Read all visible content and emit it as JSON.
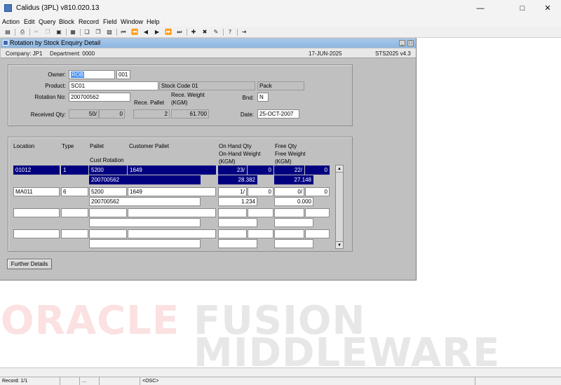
{
  "window": {
    "title": "Calidus (3PL) v810.020.13"
  },
  "menu": [
    "Action",
    "Edit",
    "Query",
    "Block",
    "Record",
    "Field",
    "Window",
    "Help"
  ],
  "form": {
    "title": "Rotation by Stock Enquiry Detail",
    "company": "Company:  JP1",
    "department": "Department:  0000",
    "date": "17-JUN-2025",
    "version_code": "STS2025  v4.3"
  },
  "header": {
    "owner_label": "Owner:",
    "owner": "ROB",
    "owner_code": "001",
    "product_label": "Product:",
    "product": "SC01",
    "product_desc": "Stock Code 01",
    "pack": "Pack",
    "rotation_label": "Rotation No:",
    "rotation_no": "200700562",
    "rece_weight_label_1": "Rece. Weight",
    "rece_weight_label_2": "(KGM)",
    "rece_pallet_label": "Rece. Pallet",
    "bnd_label": "Bnd:",
    "bnd": "N",
    "received_qty_label": "Received Qty:",
    "received_qty_1": "50/",
    "received_qty_2": "0",
    "rece_pallet": "2",
    "rece_weight": "61.700",
    "date_label": "Date:",
    "date": "25-OCT-2007"
  },
  "grid": {
    "headers": {
      "location": "Location",
      "type": "Type",
      "pallet": "Pallet",
      "customer_pallet": "Customer Pallet",
      "on_hand_1": "On Hand Qty",
      "on_hand_2": "On-Hand Weight",
      "on_hand_3": "(KGM)",
      "free_1": "Free Qty",
      "free_2": "Free Weight",
      "free_3": "(KGM)",
      "cust_rotation": "Cust Rotation"
    },
    "rows": [
      {
        "location": "01012",
        "type": "1",
        "pallet": "5200",
        "customer_pallet": "1649",
        "on_hand_qty": "23/",
        "on_hand_qty2": "0",
        "free_qty": "22/",
        "free_qty2": "0",
        "cust_rotation": "200700562",
        "on_hand_weight": "28.382",
        "free_weight": "27.148"
      },
      {
        "location": "MA011",
        "type": "6",
        "pallet": "5200",
        "customer_pallet": "1649",
        "on_hand_qty": "1/",
        "on_hand_qty2": "0",
        "free_qty": "0/",
        "free_qty2": "0",
        "cust_rotation": "200700562",
        "on_hand_weight": "1.234",
        "free_weight": "0.000"
      },
      {
        "location": "",
        "type": "",
        "pallet": "",
        "customer_pallet": "",
        "on_hand_qty": "",
        "on_hand_qty2": "",
        "free_qty": "",
        "free_qty2": "",
        "cust_rotation": "",
        "on_hand_weight": "",
        "free_weight": ""
      },
      {
        "location": "",
        "type": "",
        "pallet": "",
        "customer_pallet": "",
        "on_hand_qty": "",
        "on_hand_qty2": "",
        "free_qty": "",
        "free_qty2": "",
        "cust_rotation": "",
        "on_hand_weight": "",
        "free_weight": ""
      }
    ]
  },
  "buttons": {
    "further_details": "Further Details"
  },
  "watermark": {
    "oracle": "ORACLE",
    "fusion": "FUSION",
    "middleware": "MIDDLEWARE"
  },
  "status": {
    "record": "Record: 1/1",
    "dots": "...",
    "osc": "<OSC>"
  }
}
